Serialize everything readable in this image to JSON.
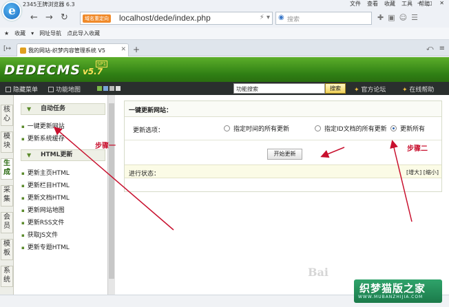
{
  "browser": {
    "title": "2345王牌浏览器 6.3",
    "menu": [
      "文件",
      "查看",
      "收藏",
      "工具",
      "帮助"
    ],
    "domain_badge": "域名重定向",
    "url": "localhost/dede/index.php",
    "search_placeholder": "搜索",
    "favorites_label": "收藏",
    "nav_site": "网址导航",
    "import_favorites": "点此导入收藏",
    "tab_title": "我的网站-织梦内容管理系统 V5"
  },
  "cms": {
    "logo": "DEDECMS",
    "version": "v5.7",
    "edition": "SP1",
    "toolbar": {
      "hide_menu": "隐藏菜单",
      "function_map": "功能地图",
      "search_value": "功能搜索",
      "search_button": "搜索",
      "forum": "官方论坛",
      "help": "在线帮助"
    },
    "colors": {
      "header": "#3c8f1e",
      "toolbar": "#2a2f2e",
      "annotation": "#c8102e"
    }
  },
  "vtabs": [
    {
      "label": "核心"
    },
    {
      "label": "模块"
    },
    {
      "label": "生成"
    },
    {
      "label": "采集"
    },
    {
      "label": "会员"
    },
    {
      "label": "模板"
    },
    {
      "label": "系统"
    }
  ],
  "leftmenu": {
    "section1": "自动任务",
    "section1_items": [
      "一键更新网站",
      "更新系统缓存"
    ],
    "section2": "HTML更新",
    "section2_items": [
      "更新主页HTML",
      "更新栏目HTML",
      "更新文档HTML",
      "更新网站地图",
      "更新RSS文件",
      "获取JS文件",
      "更新专题HTML"
    ]
  },
  "main": {
    "panel_title": "一键更新网站：",
    "option_label": "更新选项：",
    "options": [
      "指定时间的所有更新",
      "指定ID文档的所有更新",
      "更新所有"
    ],
    "selected_option": "更新所有",
    "start_button": "开始更新",
    "status_label": "进行状态：",
    "zoom_in": "[增大]",
    "zoom_out": "[缩小]"
  },
  "annotations": {
    "step1": "步骤一",
    "step2": "步骤二"
  },
  "watermark": {
    "text": "织梦猫版之家",
    "url": "WWW.MUBANZHIJIA.COM",
    "baidu": "Bai"
  }
}
